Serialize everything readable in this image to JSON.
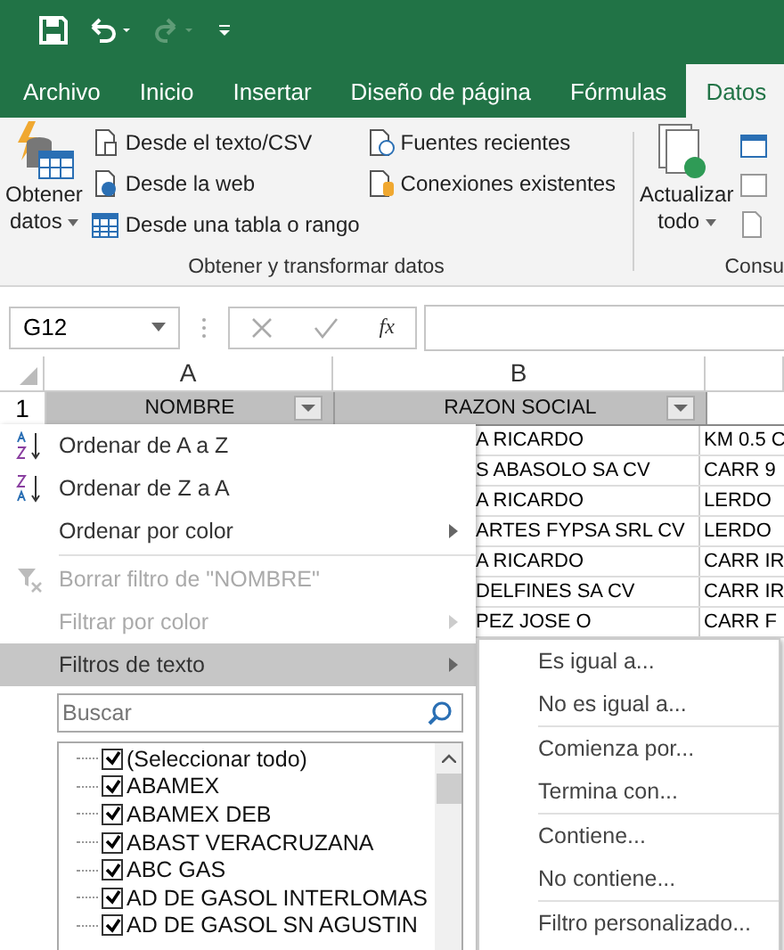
{
  "tabs": [
    {
      "label": "Archivo",
      "selected": false
    },
    {
      "label": "Inicio",
      "selected": false
    },
    {
      "label": "Insertar",
      "selected": false
    },
    {
      "label": "Diseño de página",
      "selected": false
    },
    {
      "label": "Fórmulas",
      "selected": false
    },
    {
      "label": "Datos",
      "selected": true
    }
  ],
  "ribbon": {
    "get_data": {
      "line1": "Obtener",
      "line2": "datos"
    },
    "small_buttons": [
      {
        "label": "Desde el texto/CSV",
        "kind": "text"
      },
      {
        "label": "Desde la web",
        "kind": "web"
      },
      {
        "label": "Desde una tabla o rango",
        "kind": "table"
      }
    ],
    "small_buttons_2": [
      {
        "label": "Fuentes recientes",
        "kind": "recent"
      },
      {
        "label": "Conexiones existentes",
        "kind": "connections"
      }
    ],
    "group_label": "Obtener y transformar datos",
    "refresh": {
      "line1": "Actualizar",
      "line2": "todo"
    },
    "group_label_2": "Consu"
  },
  "formula_bar": {
    "name_box": "G12",
    "fx": "fx"
  },
  "columns": [
    "A",
    "B"
  ],
  "header_row": {
    "number": "1",
    "cells": [
      "NOMBRE",
      "RAZON SOCIAL"
    ]
  },
  "rows": [
    [
      "A RICARDO",
      "KM 0.5 C"
    ],
    [
      "S ABASOLO SA CV",
      "CARR 9"
    ],
    [
      "A RICARDO",
      "LERDO"
    ],
    [
      "ARTES FYPSA SRL CV",
      "LERDO"
    ],
    [
      "A RICARDO",
      "CARR IR"
    ],
    [
      "DELFINES SA CV",
      "CARR IR"
    ],
    [
      "PEZ JOSE O",
      "CARR F"
    ]
  ],
  "filter_menu": {
    "items": [
      {
        "label": "Ordenar de A a Z",
        "kind": "sort-az",
        "disabled": false,
        "selected": false,
        "submenu": false
      },
      {
        "label": "Ordenar de Z a A",
        "kind": "sort-za",
        "disabled": false,
        "selected": false,
        "submenu": false
      },
      {
        "label": "Ordenar por color",
        "kind": "plain",
        "disabled": false,
        "selected": false,
        "submenu": true
      },
      {
        "kind": "separator"
      },
      {
        "label": "Borrar filtro de \"NOMBRE\"",
        "kind": "clear",
        "disabled": true,
        "selected": false,
        "submenu": false
      },
      {
        "label": "Filtrar por color",
        "kind": "plain",
        "disabled": true,
        "selected": false,
        "submenu": true
      },
      {
        "label": "Filtros de texto",
        "kind": "plain",
        "disabled": false,
        "selected": true,
        "submenu": true
      }
    ],
    "search": {
      "placeholder": "Buscar"
    },
    "values": [
      {
        "label": "(Seleccionar todo)",
        "checked": true
      },
      {
        "label": "ABAMEX",
        "checked": true
      },
      {
        "label": "ABAMEX DEB",
        "checked": true
      },
      {
        "label": "ABAST VERACRUZANA",
        "checked": true
      },
      {
        "label": "ABC GAS",
        "checked": true
      },
      {
        "label": "AD DE GASOL INTERLOMAS",
        "checked": true
      },
      {
        "label": "AD DE GASOL SN AGUSTIN",
        "checked": true
      }
    ]
  },
  "text_filters_menu": [
    {
      "label": "Es igual a...",
      "kind": "item"
    },
    {
      "label": "No es igual a...",
      "kind": "item"
    },
    {
      "kind": "separator"
    },
    {
      "label": "Comienza por...",
      "kind": "item"
    },
    {
      "label": "Termina con...",
      "kind": "item"
    },
    {
      "kind": "separator"
    },
    {
      "label": "Contiene...",
      "kind": "item"
    },
    {
      "label": "No contiene...",
      "kind": "item"
    },
    {
      "kind": "separator"
    },
    {
      "label": "Filtro personalizado...",
      "kind": "item"
    }
  ]
}
